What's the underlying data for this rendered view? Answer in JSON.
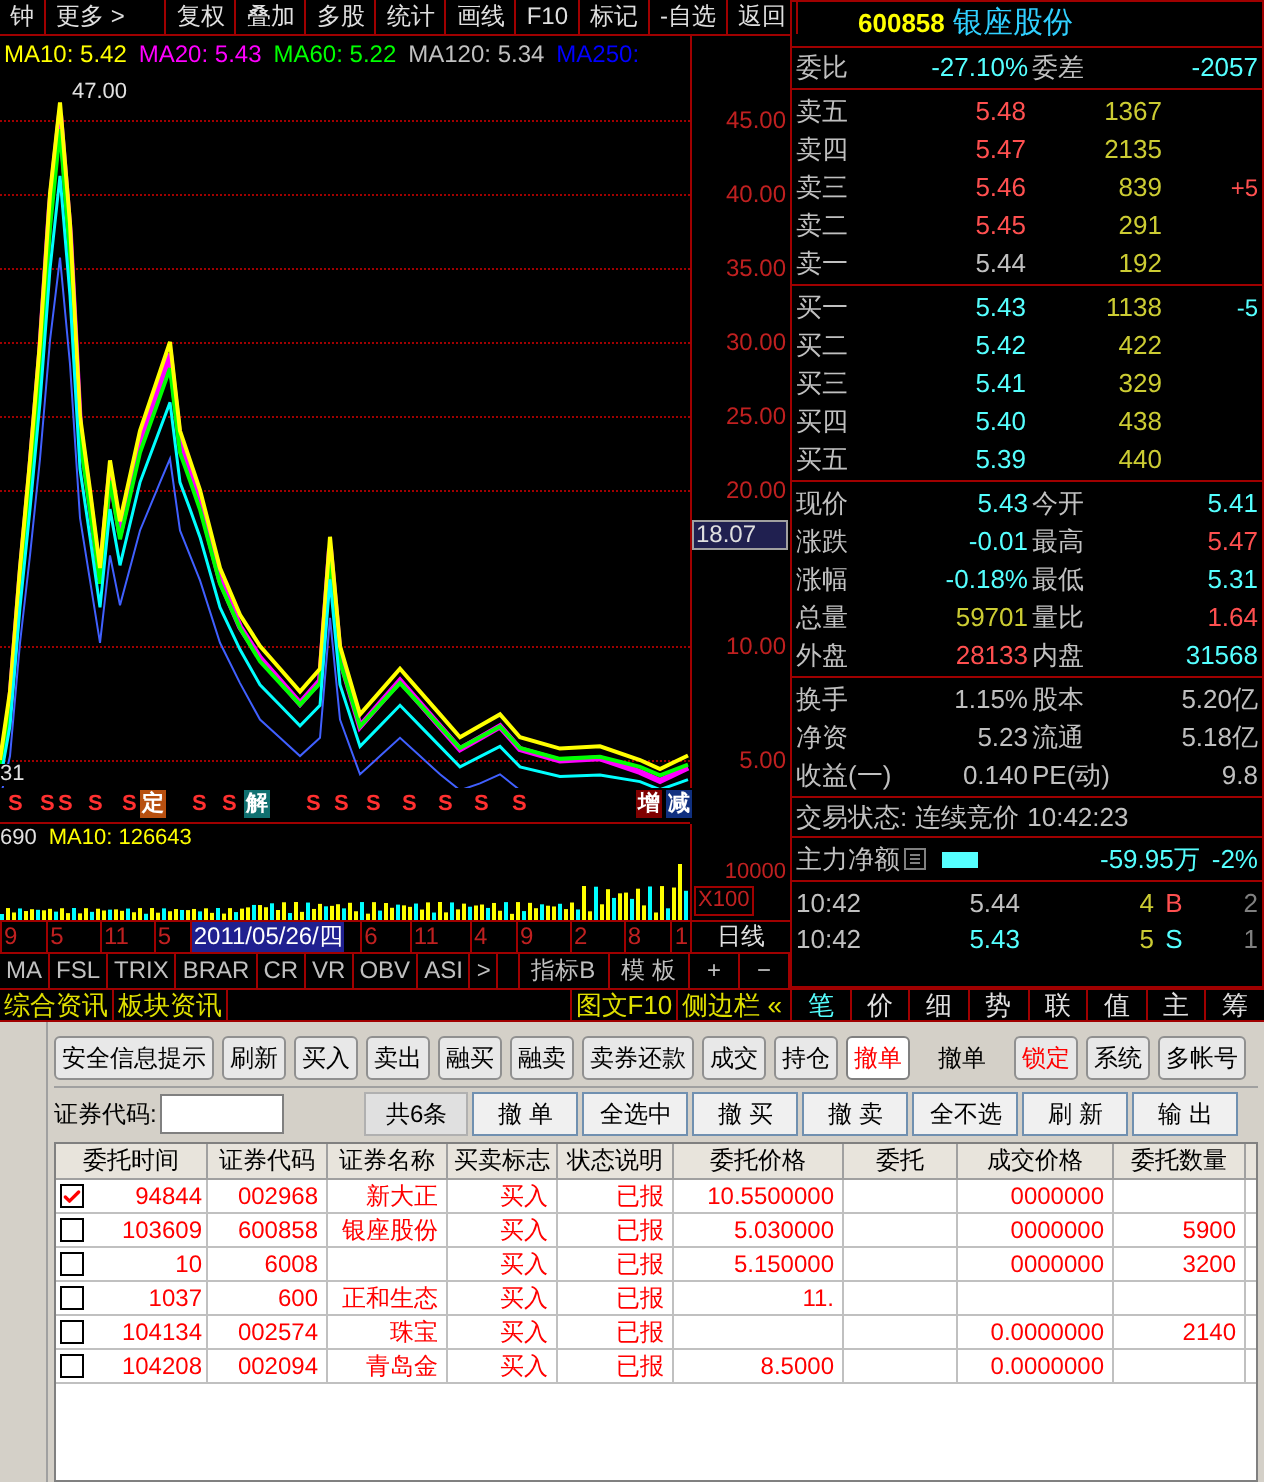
{
  "menu_bar": {
    "items": [
      {
        "label": "钟"
      },
      {
        "label": "更多 >"
      },
      {
        "label": "复权"
      },
      {
        "label": "叠加"
      },
      {
        "label": "多股"
      },
      {
        "label": "统计"
      },
      {
        "label": "画线"
      },
      {
        "label": "F10"
      },
      {
        "label": "标记"
      },
      {
        "label": "-自选"
      },
      {
        "label": "返回"
      }
    ]
  },
  "ma_legend": [
    {
      "label": "MA10: 5.42",
      "color": "#ffff00"
    },
    {
      "label": "MA20: 5.43",
      "color": "#ff00ff"
    },
    {
      "label": "MA60: 5.22",
      "color": "#00ff00"
    },
    {
      "label": "MA120: 5.34",
      "color": "#c0c0c0"
    },
    {
      "label": "MA250:",
      "color": "#0000ff"
    }
  ],
  "price_chart": {
    "peak_label": "47.00",
    "axis_labels": [
      "45.00",
      "40.00",
      "35.00",
      "30.00",
      "25.00",
      "20.00",
      "10.00",
      "5.00"
    ],
    "current_price": "18.07",
    "left_label": "31"
  },
  "signals": [
    {
      "label": "S",
      "kind": "signal"
    },
    {
      "label": "S",
      "kind": "signal"
    },
    {
      "label": "S",
      "kind": "signal"
    },
    {
      "label": "S",
      "kind": "signal"
    },
    {
      "label": "S",
      "kind": "signal"
    },
    {
      "label": "定",
      "kind": "fixed"
    },
    {
      "label": "S",
      "kind": "signal"
    },
    {
      "label": "S",
      "kind": "signal"
    },
    {
      "label": "解",
      "kind": "unlock"
    },
    {
      "label": "S",
      "kind": "signal"
    },
    {
      "label": "S",
      "kind": "signal"
    },
    {
      "label": "S",
      "kind": "signal"
    },
    {
      "label": "S",
      "kind": "signal"
    },
    {
      "label": "S",
      "kind": "signal"
    },
    {
      "label": "S",
      "kind": "signal"
    },
    {
      "label": "S",
      "kind": "signal"
    },
    {
      "label": "增",
      "kind": "add"
    },
    {
      "label": "减",
      "kind": "reduce"
    }
  ],
  "volume": {
    "label": "690",
    "ma_label": "MA10: 126643",
    "axis_label": "10000",
    "unit": "X100"
  },
  "date_axis": [
    {
      "label": "9",
      "selected": false
    },
    {
      "label": "5",
      "selected": false
    },
    {
      "label": "11",
      "selected": false
    },
    {
      "label": "5",
      "selected": false
    },
    {
      "label": "2011/05/26/四",
      "selected": true
    },
    {
      "label": "6",
      "selected": false
    },
    {
      "label": "11",
      "selected": false
    },
    {
      "label": "4",
      "selected": false
    },
    {
      "label": "9",
      "selected": false
    },
    {
      "label": "2",
      "selected": false
    },
    {
      "label": "8",
      "selected": false
    },
    {
      "label": "1",
      "selected": false
    }
  ],
  "period": "日线",
  "indicator_tabs": [
    {
      "label": "MA"
    },
    {
      "label": "FSL"
    },
    {
      "label": "TRIX"
    },
    {
      "label": "BRAR"
    },
    {
      "label": "CR"
    },
    {
      "label": "VR"
    },
    {
      "label": "OBV"
    },
    {
      "label": "ASI"
    },
    {
      "label": ">"
    }
  ],
  "indicator_buttons": [
    {
      "label": "指标B"
    },
    {
      "label": "模 板"
    },
    {
      "label": "+"
    },
    {
      "label": "−"
    }
  ],
  "quote": {
    "code": "600858",
    "name": "银座股份",
    "ratio": {
      "label": "委比",
      "value": "-27.10%",
      "diff_label": "委差",
      "diff": "-2057"
    },
    "asks": [
      {
        "label": "卖五",
        "price": "5.48",
        "volume": "1367",
        "color": "#ff5050"
      },
      {
        "label": "卖四",
        "price": "5.47",
        "volume": "2135",
        "color": "#ff5050"
      },
      {
        "label": "卖三",
        "price": "5.46",
        "volume": "839",
        "color": "#ff5050",
        "change": "+5"
      },
      {
        "label": "卖二",
        "price": "5.45",
        "volume": "291",
        "color": "#ff5050"
      },
      {
        "label": "卖一",
        "price": "5.44",
        "volume": "192",
        "color": "#c0c0c0"
      }
    ],
    "bids": [
      {
        "label": "买一",
        "price": "5.43",
        "volume": "1138",
        "color": "#55ffff",
        "change": "-5"
      },
      {
        "label": "买二",
        "price": "5.42",
        "volume": "422",
        "color": "#55ffff"
      },
      {
        "label": "买三",
        "price": "5.41",
        "volume": "329",
        "color": "#55ffff"
      },
      {
        "label": "买四",
        "price": "5.40",
        "volume": "438",
        "color": "#55ffff"
      },
      {
        "label": "买五",
        "price": "5.39",
        "volume": "440",
        "color": "#55ffff"
      }
    ],
    "stats": [
      {
        "left": {
          "label": "现价",
          "value": "5.43",
          "color": "#55ffff"
        },
        "right": {
          "label": "今开",
          "value": "5.41",
          "color": "#55ffff"
        }
      },
      {
        "left": {
          "label": "涨跌",
          "value": "-0.01",
          "color": "#55ffff"
        },
        "right": {
          "label": "最高",
          "value": "5.47",
          "color": "#ff5050"
        }
      },
      {
        "left": {
          "label": "涨幅",
          "value": "-0.18%",
          "color": "#55ffff"
        },
        "right": {
          "label": "最低",
          "value": "5.31",
          "color": "#55ffff"
        }
      },
      {
        "left": {
          "label": "总量",
          "value": "59701",
          "color": "#cccc33"
        },
        "right": {
          "label": "量比",
          "value": "1.64",
          "color": "#ff5050"
        }
      },
      {
        "left": {
          "label": "外盘",
          "value": "28133",
          "color": "#ff5050"
        },
        "right": {
          "label": "内盘",
          "value": "31568",
          "color": "#55ffff"
        }
      }
    ],
    "info": [
      {
        "label": "换手",
        "value": "1.15%",
        "label2": "股本",
        "value2": "5.20亿"
      },
      {
        "label": "净资",
        "value": "5.23",
        "label2": "流通",
        "value2": "5.18亿"
      },
      {
        "label": "收益(一)",
        "value": "0.140",
        "label2": "PE(动)",
        "value2": "9.8"
      }
    ],
    "trade_status": {
      "label": "交易状态:",
      "value": "连续竞价",
      "time": "10:42:23"
    },
    "main_flow": {
      "label": "主力净额",
      "value": "-59.95万",
      "percent": "-2%",
      "level": 0.35
    },
    "ticks": [
      {
        "time": "10:42",
        "price": {
          "value": "5.44",
          "color": "#c0c0c0"
        },
        "volume": "4",
        "side": {
          "value": "B",
          "color": "#ff5050"
        },
        "count": "2"
      },
      {
        "time": "10:42",
        "price": {
          "value": "5.43",
          "color": "#55ffff"
        },
        "volume": "5",
        "side": {
          "value": "S",
          "color": "#55ffff"
        },
        "count": "1"
      }
    ]
  },
  "info_bar": {
    "left": [
      {
        "label": "综合资讯"
      },
      {
        "label": "板块资讯"
      }
    ],
    "right": [
      {
        "label": "图文F10"
      },
      {
        "label": "侧边栏 «"
      }
    ],
    "tabs": [
      {
        "label": "笔",
        "selected": true
      },
      {
        "label": "价",
        "selected": false
      },
      {
        "label": "细",
        "selected": false
      },
      {
        "label": "势",
        "selected": false
      },
      {
        "label": "联",
        "selected": false
      },
      {
        "label": "值",
        "selected": false
      },
      {
        "label": "主",
        "selected": false
      },
      {
        "label": "筹",
        "selected": false
      }
    ]
  },
  "toolbar": [
    {
      "label": "安全信息提示",
      "selected": false
    },
    {
      "label": "刷新",
      "selected": false
    },
    {
      "label": "买入",
      "selected": false
    },
    {
      "label": "卖出",
      "selected": false
    },
    {
      "label": "融买",
      "selected": false
    },
    {
      "label": "融卖",
      "selected": false
    },
    {
      "label": "卖券还款",
      "selected": false
    },
    {
      "label": "成交",
      "selected": false
    },
    {
      "label": "持仓",
      "selected": false
    },
    {
      "label": "撤单",
      "selected": true
    }
  ],
  "panel_title": "撤单",
  "toolbar_right": [
    {
      "label": "锁定",
      "kind": "alert",
      "selected": false
    },
    {
      "label": "系统",
      "kind": "button",
      "selected": false
    },
    {
      "label": "多帐号",
      "kind": "button",
      "selected": false
    }
  ],
  "form": {
    "code_label": "证券代码:",
    "count": "共6条",
    "buttons": [
      {
        "label": "撤 单"
      },
      {
        "label": "全选中"
      },
      {
        "label": "撤 买"
      },
      {
        "label": "撤 卖"
      },
      {
        "label": "全不选"
      },
      {
        "label": "刷 新"
      },
      {
        "label": "输 出"
      }
    ]
  },
  "table": {
    "columns": [
      "委托时间",
      "证券代码",
      "证券名称",
      "买卖标志",
      "状态说明",
      "委托价格",
      "委托",
      "成交价格",
      "委托数量"
    ],
    "rows": [
      {
        "checked": true,
        "time": "94844",
        "code": "002968",
        "name": "新大正",
        "side": "买入",
        "status": "已报",
        "price": "10.5500000",
        "filled_price": "0000000"
      },
      {
        "checked": false,
        "time": "103609",
        "code": "600858",
        "name": "银座股份",
        "side": "买入",
        "status": "已报",
        "price": "5.030000",
        "filled_price": "0000000",
        "quantity": "5900"
      },
      {
        "checked": false,
        "time": "10",
        "code": "6008",
        "side": "买入",
        "status": "已报",
        "price": "5.150000",
        "filled_price": "0000000",
        "quantity": "3200"
      },
      {
        "checked": false,
        "time": "1037",
        "code": "600",
        "name": "正和生态",
        "side": "买入",
        "status": "已报",
        "price": "11."
      },
      {
        "checked": false,
        "time": "104134",
        "code": "002574",
        "name": "珠宝",
        "side": "买入",
        "status": "已报",
        "filled_price": "0.0000000",
        "quantity": "2140"
      },
      {
        "checked": false,
        "time": "104208",
        "code": "002094",
        "name": "青岛金",
        "side": "买入",
        "status": "已报",
        "price": "8.5000",
        "filled_price": "0.0000000"
      }
    ]
  }
}
